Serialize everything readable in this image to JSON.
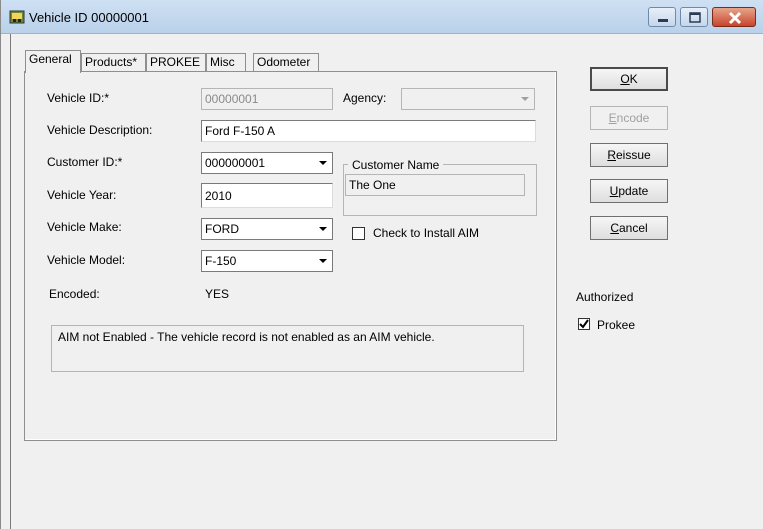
{
  "window": {
    "title": "Vehicle ID 00000001",
    "controls": {
      "minimize": "minimize-icon",
      "maximize": "maximize-icon",
      "close": "close-icon"
    }
  },
  "tabs": [
    {
      "label": "General",
      "active": true
    },
    {
      "label": "Products*",
      "active": false
    },
    {
      "label": "PROKEE",
      "active": false
    },
    {
      "label": "Misc",
      "active": false
    },
    {
      "label": "Odometer",
      "active": false
    }
  ],
  "form": {
    "vehicle_id_label": "Vehicle ID:*",
    "vehicle_id_value": "00000001",
    "agency_label": "Agency:",
    "agency_value": "",
    "description_label": "Vehicle Description:",
    "description_value": "Ford F-150 A",
    "customer_id_label": "Customer ID:*",
    "customer_id_value": "000000001",
    "customer_name_title": "Customer Name",
    "customer_name_value": "The One",
    "year_label": "Vehicle Year:",
    "year_value": "2010",
    "make_label": "Vehicle Make:",
    "make_value": "FORD",
    "install_aim_label": "Check to Install AIM",
    "install_aim_checked": false,
    "model_label": "Vehicle Model:",
    "model_value": "F-150",
    "encoded_label": "Encoded:",
    "encoded_value": "YES",
    "message": "AIM not Enabled - The vehicle record is not enabled as an AIM vehicle."
  },
  "buttons": {
    "ok_u": "O",
    "ok_rest": "K",
    "encode_u": "E",
    "encode_rest": "ncode",
    "reissue_u": "R",
    "reissue_rest": "eissue",
    "update_u": "U",
    "update_rest": "pdate",
    "cancel_u": "C",
    "cancel_rest": "ancel"
  },
  "authorized": {
    "title": "Authorized",
    "prokee_label": "Prokee",
    "prokee_checked": true
  }
}
